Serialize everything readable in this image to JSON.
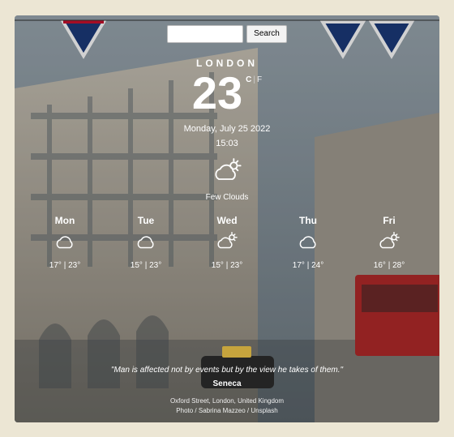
{
  "search": {
    "button": "Search"
  },
  "city": "LONDON",
  "current": {
    "temp": "23",
    "unit_c": "C",
    "unit_f": "F",
    "date": "Monday, July 25 2022",
    "time": "15:03",
    "desc": "Few Clouds"
  },
  "forecast": [
    {
      "day": "Mon",
      "icon": "cloud",
      "lo": "17°",
      "hi": "23°"
    },
    {
      "day": "Tue",
      "icon": "cloud",
      "lo": "15°",
      "hi": "23°"
    },
    {
      "day": "Wed",
      "icon": "cloud-sun",
      "lo": "15°",
      "hi": "23°"
    },
    {
      "day": "Thu",
      "icon": "cloud",
      "lo": "17°",
      "hi": "24°"
    },
    {
      "day": "Fri",
      "icon": "cloud-sun",
      "lo": "16°",
      "hi": "28°"
    }
  ],
  "quote": {
    "text": "\"Man is affected not by events but by the view he takes of them.\"",
    "author": "Seneca"
  },
  "credits": {
    "location": "Oxford Street, London, United Kingdom",
    "photo": "Photo / Sabrina Mazzeo / Unsplash"
  }
}
